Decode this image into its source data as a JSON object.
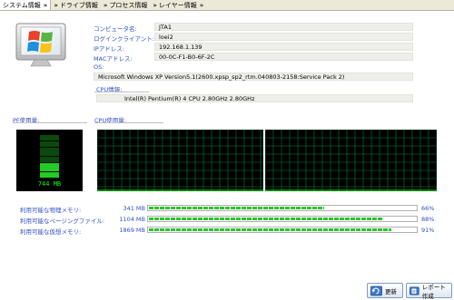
{
  "tabs": [
    {
      "label": "システム情報",
      "chevron": "»",
      "active": true
    },
    {
      "label": "ドライブ情報",
      "chevron": "»"
    },
    {
      "label": "プロセス情報",
      "chevron": "»"
    },
    {
      "label": "レイヤー情報",
      "chevron": "»"
    }
  ],
  "system": {
    "computer_name_label": "コンピュータ名:",
    "computer_name": "JTA1",
    "login_client_label": "ログインクライアント:",
    "login_client": "loei2",
    "ip_label": "IPアドレス:",
    "ip": "192.168.1.139",
    "mac_label": "MACアドレス:",
    "mac": "00-0C-F1-B0-6F-2C",
    "os_label": "OS:",
    "os": "Microsoft Windows XP Version5.1(2600.xpsp_sp2_rtm.040803-2158:Service Pack 2)",
    "cpu_info_label": "CPU情報:",
    "cpu_info": "Intel(R) Pentium(R) 4 CPU 2.80GHz  2.80GHz"
  },
  "monitors": {
    "pf_label": "PF使用量:",
    "pf_value": "744 MB",
    "cpu_label": "CPU使用量:"
  },
  "memory": [
    {
      "label": "利用可能な物理メモリ:",
      "value": "341 MB",
      "percent": "66%",
      "fill": 0.66
    },
    {
      "label": "利用可能なページングファイル:",
      "value": "1104 MB",
      "percent": "88%",
      "fill": 0.88
    },
    {
      "label": "利用可能な仮想メモリ:",
      "value": "1869 MB",
      "percent": "91%",
      "fill": 0.91
    }
  ],
  "buttons": {
    "refresh": "更新",
    "report": "レポート作成"
  }
}
